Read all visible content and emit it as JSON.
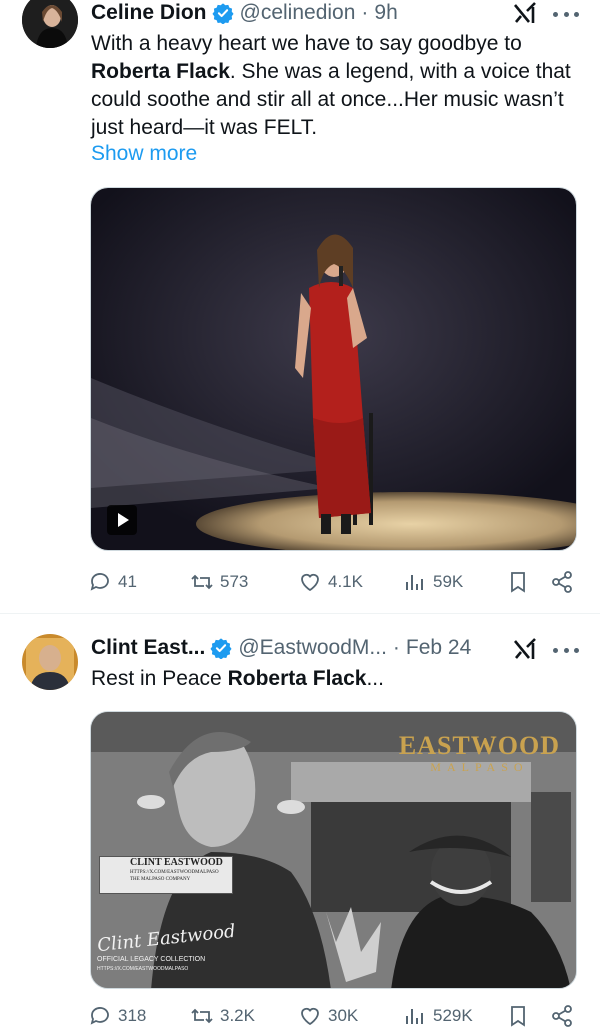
{
  "tweets": [
    {
      "name": "Celine Dion",
      "handle": "@celinedion",
      "time": "9h",
      "text_before": "With a heavy heart we have to say goodbye to ",
      "text_bold": "Roberta Flack",
      "text_after": ".  She was a legend, with a voice that could soothe and stir all at once...Her music wasn’t just heard—it was FELT.",
      "show_more": "Show more",
      "stats": {
        "replies": "41",
        "reposts": "573",
        "likes": "4.1K",
        "views": "59K"
      }
    },
    {
      "name": "Clint East...",
      "handle": "@EastwoodM...",
      "time": "Feb 24",
      "text_before": "Rest in Peace ",
      "text_bold": "Roberta Flack",
      "text_after": "...",
      "stats": {
        "replies": "318",
        "reposts": "3.2K",
        "likes": "30K",
        "views": "529K"
      },
      "image_text": {
        "brand_top": "EASTWOOD",
        "brand_bottom": "MALPASO",
        "card_title": "CLINT EASTWOOD",
        "card_url": "HTTPS://X.COM/EASTWOODMALPASO",
        "card_company": "THE MALPASO COMPANY",
        "signature": "Clint Eastwood",
        "legacy_1": "OFFICIAL LEGACY COLLECTION",
        "legacy_2": "HTTPS://X.COM/EASTWOODMALPASO"
      }
    }
  ],
  "colors": {
    "accent": "#1d9bf0",
    "muted": "#536471",
    "text": "#0f1419",
    "media_red": "#b3201c"
  },
  "icons": [
    "verified-badge-icon",
    "grok-icon",
    "more-icon",
    "play-icon",
    "reply-icon",
    "repost-icon",
    "like-icon",
    "views-icon",
    "bookmark-icon",
    "share-icon"
  ]
}
